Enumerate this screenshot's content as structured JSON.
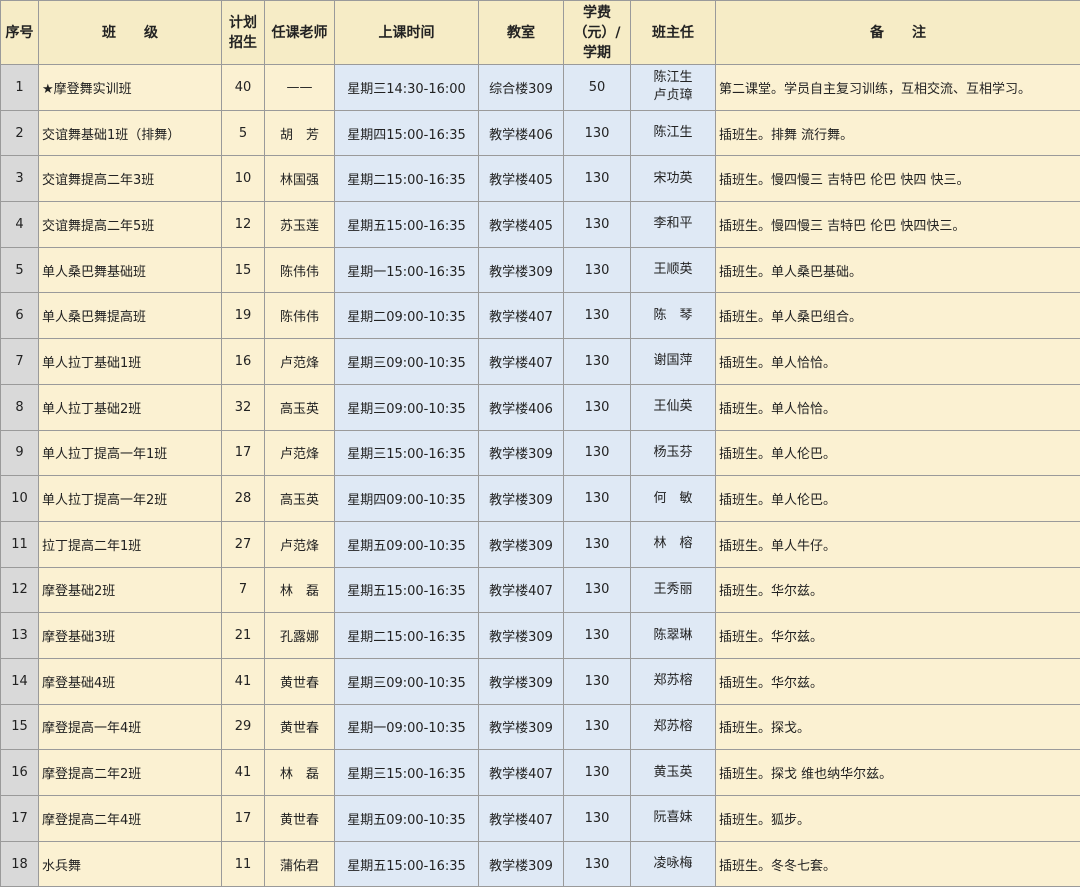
{
  "headers": {
    "index": "序号",
    "class": "班　　级",
    "enroll": "计划招生",
    "teacher": "任课老师",
    "time": "上课时间",
    "room": "教室",
    "fee": "学费（元）/学期",
    "manager": "班主任",
    "note": "备　　注"
  },
  "rows": [
    {
      "idx": "1",
      "class": "★摩登舞实训班",
      "enroll": "40",
      "teacher": "——",
      "time": "星期三14:30-16:00",
      "room": "综合楼309",
      "fee": "50",
      "manager": "陈江生",
      "manager2": "卢贞璋",
      "note": "第二课堂。学员自主复习训练，互相交流、互相学习。"
    },
    {
      "idx": "2",
      "class": "交谊舞基础1班（排舞）",
      "enroll": "5",
      "teacher": "胡　芳",
      "time": "星期四15:00-16:35",
      "room": "教学楼406",
      "fee": "130",
      "manager": "陈江生",
      "manager2": "",
      "note": "插班生。排舞 流行舞。"
    },
    {
      "idx": "3",
      "class": "交谊舞提高二年3班",
      "enroll": "10",
      "teacher": "林国强",
      "time": "星期二15:00-16:35",
      "room": "教学楼405",
      "fee": "130",
      "manager": "宋功英",
      "manager2": "",
      "note": "插班生。慢四慢三 吉特巴 伦巴 快四 快三。"
    },
    {
      "idx": "4",
      "class": "交谊舞提高二年5班",
      "enroll": "12",
      "teacher": "苏玉莲",
      "time": "星期五15:00-16:35",
      "room": "教学楼405",
      "fee": "130",
      "manager": "李和平",
      "manager2": "",
      "note": "插班生。慢四慢三 吉特巴 伦巴 快四快三。"
    },
    {
      "idx": "5",
      "class": "单人桑巴舞基础班",
      "enroll": "15",
      "teacher": "陈伟伟",
      "time": "星期一15:00-16:35",
      "room": "教学楼309",
      "fee": "130",
      "manager": "王顺英",
      "manager2": "",
      "note": "插班生。单人桑巴基础。"
    },
    {
      "idx": "6",
      "class": "单人桑巴舞提高班",
      "enroll": "19",
      "teacher": "陈伟伟",
      "time": "星期二09:00-10:35",
      "room": "教学楼407",
      "fee": "130",
      "manager": "陈　琴",
      "manager2": "",
      "note": "插班生。单人桑巴组合。"
    },
    {
      "idx": "7",
      "class": "单人拉丁基础1班",
      "enroll": "16",
      "teacher": "卢范烽",
      "time": "星期三09:00-10:35",
      "room": "教学楼407",
      "fee": "130",
      "manager": "谢国萍",
      "manager2": "",
      "note": "插班生。单人恰恰。"
    },
    {
      "idx": "8",
      "class": "单人拉丁基础2班",
      "enroll": "32",
      "teacher": "高玉英",
      "time": "星期三09:00-10:35",
      "room": "教学楼406",
      "fee": "130",
      "manager": "王仙英",
      "manager2": "",
      "note": "插班生。单人恰恰。"
    },
    {
      "idx": "9",
      "class": "单人拉丁提高一年1班",
      "enroll": "17",
      "teacher": "卢范烽",
      "time": "星期三15:00-16:35",
      "room": "教学楼309",
      "fee": "130",
      "manager": "杨玉芬",
      "manager2": "",
      "note": "插班生。单人伦巴。"
    },
    {
      "idx": "10",
      "class": "单人拉丁提高一年2班",
      "enroll": "28",
      "teacher": "高玉英",
      "time": "星期四09:00-10:35",
      "room": "教学楼309",
      "fee": "130",
      "manager": "何　敏",
      "manager2": "",
      "note": "插班生。单人伦巴。"
    },
    {
      "idx": "11",
      "class": "拉丁提高二年1班",
      "enroll": "27",
      "teacher": "卢范烽",
      "time": "星期五09:00-10:35",
      "room": "教学楼309",
      "fee": "130",
      "manager": "林　榕",
      "manager2": "",
      "note": "插班生。单人牛仔。"
    },
    {
      "idx": "12",
      "class": "摩登基础2班",
      "enroll": "7",
      "teacher": "林　磊",
      "time": "星期五15:00-16:35",
      "room": "教学楼407",
      "fee": "130",
      "manager": "王秀丽",
      "manager2": "",
      "note": "插班生。华尔兹。"
    },
    {
      "idx": "13",
      "class": "摩登基础3班",
      "enroll": "21",
      "teacher": "孔露娜",
      "time": "星期二15:00-16:35",
      "room": "教学楼309",
      "fee": "130",
      "manager": "陈翠琳",
      "manager2": "",
      "note": "插班生。华尔兹。"
    },
    {
      "idx": "14",
      "class": "摩登基础4班",
      "enroll": "41",
      "teacher": "黄世春",
      "time": "星期三09:00-10:35",
      "room": "教学楼309",
      "fee": "130",
      "manager": "郑苏榕",
      "manager2": "",
      "note": "插班生。华尔兹。"
    },
    {
      "idx": "15",
      "class": "摩登提高一年4班",
      "enroll": "29",
      "teacher": "黄世春",
      "time": "星期一09:00-10:35",
      "room": "教学楼309",
      "fee": "130",
      "manager": "郑苏榕",
      "manager2": "",
      "note": "插班生。探戈。"
    },
    {
      "idx": "16",
      "class": "摩登提高二年2班",
      "enroll": "41",
      "teacher": "林　磊",
      "time": "星期三15:00-16:35",
      "room": "教学楼407",
      "fee": "130",
      "manager": "黄玉英",
      "manager2": "",
      "note": "插班生。探戈 维也纳华尔兹。"
    },
    {
      "idx": "17",
      "class": "摩登提高二年4班",
      "enroll": "17",
      "teacher": "黄世春",
      "time": "星期五09:00-10:35",
      "room": "教学楼407",
      "fee": "130",
      "manager": "阮喜妹",
      "manager2": "",
      "note": "插班生。狐步。"
    },
    {
      "idx": "18",
      "class": "水兵舞",
      "enroll": "11",
      "teacher": "蒲佑君",
      "time": "星期五15:00-16:35",
      "room": "教学楼309",
      "fee": "130",
      "manager": "凌咏梅",
      "manager2": "",
      "note": "插班生。冬冬七套。"
    }
  ]
}
